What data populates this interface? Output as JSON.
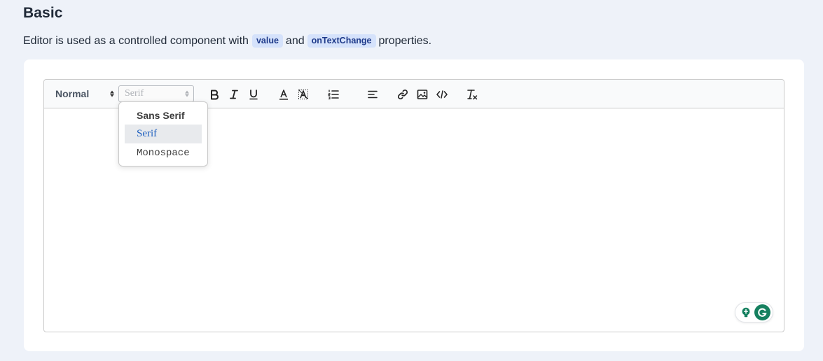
{
  "page": {
    "title": "Basic",
    "description_prefix": "Editor is used as a controlled component with",
    "code_value": "value",
    "description_and": "and",
    "code_on_text_change": "onTextChange",
    "description_suffix": "properties."
  },
  "toolbar": {
    "header_picker_value": "Normal",
    "font_picker_value": "Serif",
    "buttons": [
      {
        "name": "bold",
        "icon": "bold-icon"
      },
      {
        "name": "italic",
        "icon": "italic-icon"
      },
      {
        "name": "underline",
        "icon": "underline-icon"
      },
      {
        "name": "text-color",
        "icon": "text-color-icon"
      },
      {
        "name": "background-color",
        "icon": "background-color-icon"
      },
      {
        "name": "ordered-list",
        "icon": "ordered-list-icon"
      },
      {
        "name": "align",
        "icon": "align-left-icon"
      },
      {
        "name": "link",
        "icon": "link-icon"
      },
      {
        "name": "image",
        "icon": "image-icon"
      },
      {
        "name": "code-block",
        "icon": "code-icon"
      },
      {
        "name": "clean",
        "icon": "clear-format-icon"
      }
    ]
  },
  "font_dropdown": {
    "options": [
      "Sans Serif",
      "Serif",
      "Monospace"
    ],
    "selected": "Serif"
  },
  "editor": {
    "content": ""
  },
  "colors": {
    "background": "#eef2f9",
    "code_tag_bg": "#d5e2fb",
    "selected_option_text": "#1e5fbf",
    "grammarly_green": "#15805f"
  }
}
